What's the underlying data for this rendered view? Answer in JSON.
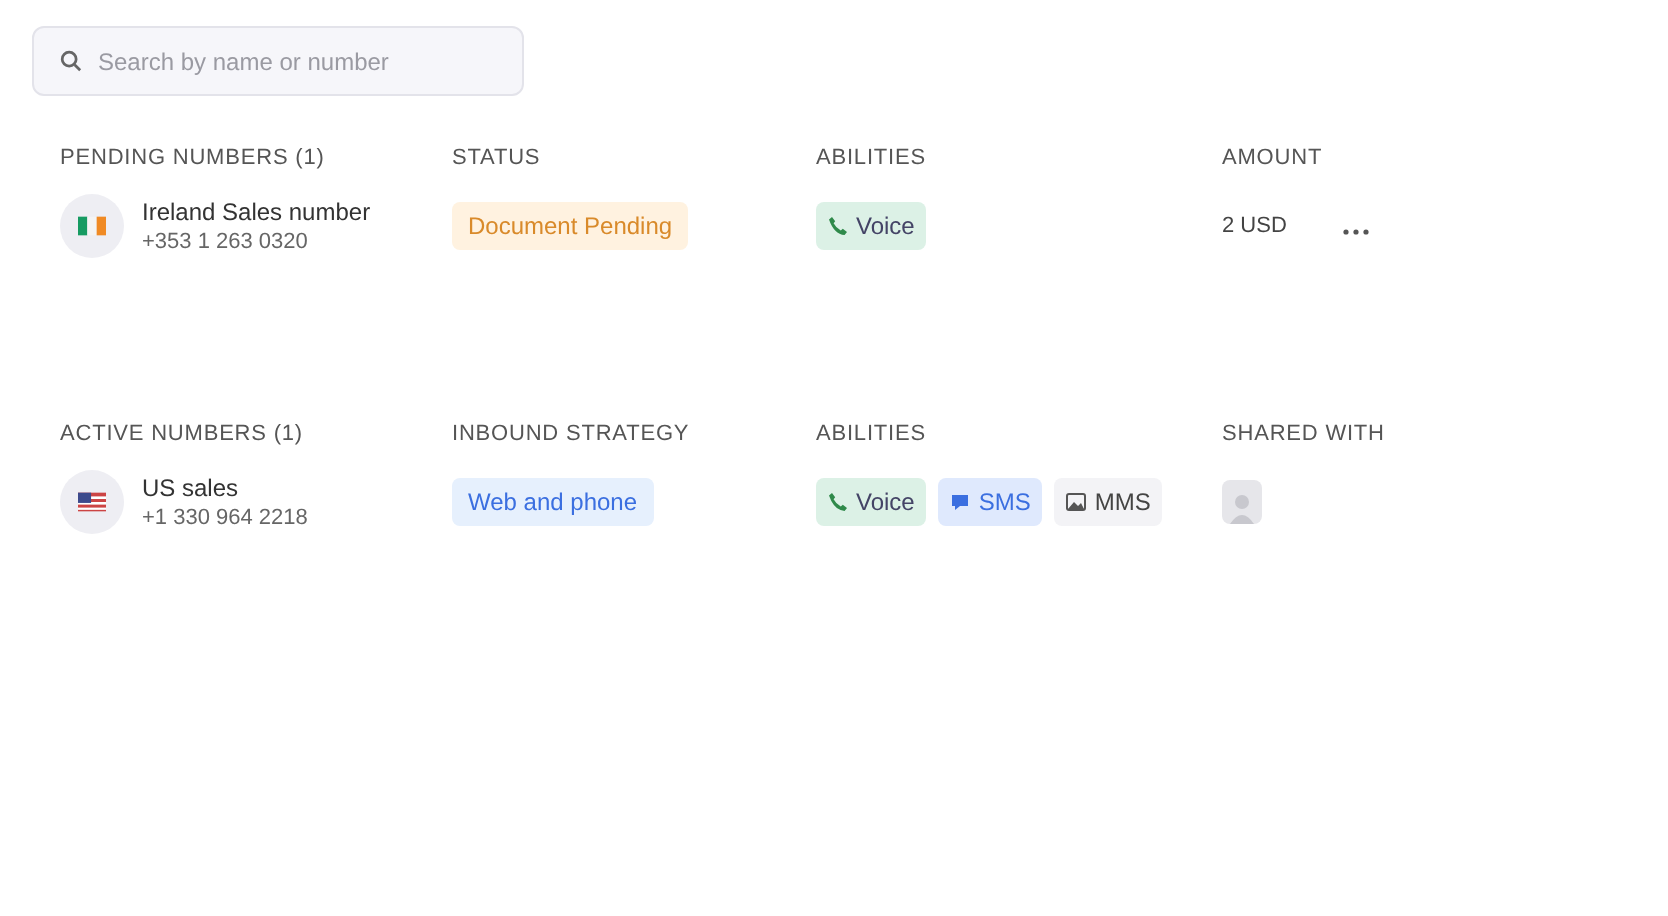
{
  "search": {
    "placeholder": "Search by name or number"
  },
  "sections": [
    {
      "kind": "pending",
      "columns": [
        "PENDING NUMBERS (1)",
        "STATUS",
        "ABILITIES",
        "AMOUNT"
      ],
      "rows": [
        {
          "name": "Ireland Sales number",
          "number": "+353 1 263 0320",
          "kind": "ireland",
          "status": {
            "text": "Document Pending",
            "kind": "warning"
          },
          "abilities": [
            {
              "label": "Voice",
              "kind": "voice"
            }
          ],
          "amount": "2 USD"
        }
      ]
    },
    {
      "kind": "active",
      "columns": [
        "ACTIVE NUMBERS (1)",
        "INBOUND STRATEGY",
        "ABILITIES",
        "SHARED WITH"
      ],
      "rows": [
        {
          "name": "US sales",
          "number": "+1 330 964 2218",
          "kind": "us",
          "status": {
            "text": "Web and phone",
            "kind": "info"
          },
          "abilities": [
            {
              "label": "Voice",
              "kind": "voice"
            },
            {
              "label": "SMS",
              "kind": "sms"
            },
            {
              "label": "MMS",
              "kind": "mms"
            }
          ]
        }
      ]
    }
  ]
}
